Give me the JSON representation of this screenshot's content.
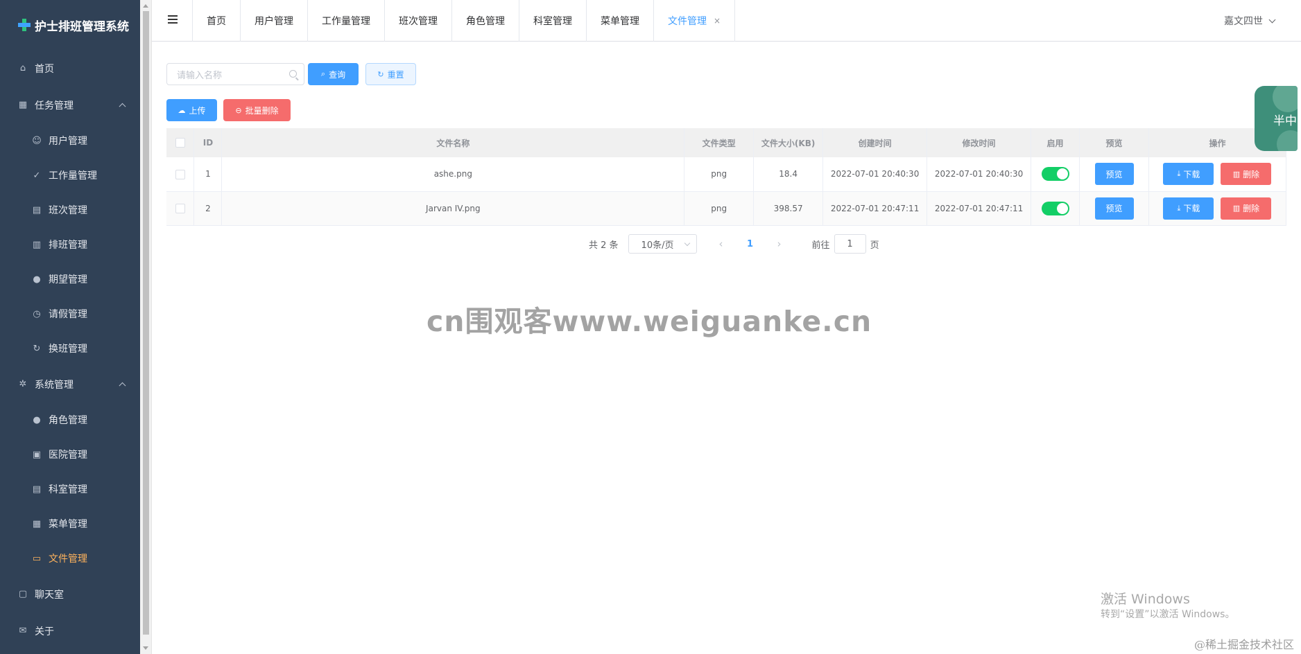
{
  "app": {
    "title": "护士排班管理系统"
  },
  "sidebar": {
    "items": [
      {
        "label": "首页",
        "icon": "home-icon",
        "level": "top"
      },
      {
        "label": "任务管理",
        "icon": "grid-icon",
        "level": "top",
        "expandable": true
      },
      {
        "label": "用户管理",
        "icon": "user-outline-icon",
        "level": "sub"
      },
      {
        "label": "工作量管理",
        "icon": "clipboard-check-icon",
        "level": "sub"
      },
      {
        "label": "班次管理",
        "icon": "clipboard-icon",
        "level": "sub"
      },
      {
        "label": "排班管理",
        "icon": "calendar-icon",
        "level": "sub"
      },
      {
        "label": "期望管理",
        "icon": "location-pin-icon",
        "level": "sub"
      },
      {
        "label": "请假管理",
        "icon": "clock-icon",
        "level": "sub"
      },
      {
        "label": "换班管理",
        "icon": "refresh-icon",
        "level": "sub"
      },
      {
        "label": "系统管理",
        "icon": "gear-icon",
        "level": "top",
        "expandable": true
      },
      {
        "label": "角色管理",
        "icon": "user-solid-icon",
        "level": "sub"
      },
      {
        "label": "医院管理",
        "icon": "office-building-icon",
        "level": "sub"
      },
      {
        "label": "科室管理",
        "icon": "building-icon",
        "level": "sub"
      },
      {
        "label": "菜单管理",
        "icon": "menu-grid-icon",
        "level": "sub"
      },
      {
        "label": "文件管理",
        "icon": "folder-icon",
        "level": "sub",
        "active": true
      },
      {
        "label": "聊天室",
        "icon": "chat-icon",
        "level": "top"
      },
      {
        "label": "关于",
        "icon": "message-icon",
        "level": "top"
      }
    ]
  },
  "header": {
    "tabs": [
      {
        "label": "首页"
      },
      {
        "label": "用户管理"
      },
      {
        "label": "工作量管理"
      },
      {
        "label": "班次管理"
      },
      {
        "label": "角色管理"
      },
      {
        "label": "科室管理"
      },
      {
        "label": "菜单管理"
      },
      {
        "label": "文件管理",
        "active": true,
        "closable": true
      }
    ],
    "close_glyph": "×",
    "user": "嘉文四世"
  },
  "toolbar": {
    "search_placeholder": "请输入名称",
    "query_label": "查询",
    "reset_label": "重置",
    "upload_label": "上传",
    "batch_delete_label": "批量删除"
  },
  "table": {
    "columns": [
      "ID",
      "文件名称",
      "文件类型",
      "文件大小(KB)",
      "创建时间",
      "修改时间",
      "启用",
      "预览",
      "操作"
    ],
    "rows": [
      {
        "id": "1",
        "name": "ashe.png",
        "type": "png",
        "size": "18.4",
        "created": "2022-07-01 20:40:30",
        "modified": "2022-07-01 20:40:30",
        "enabled": true
      },
      {
        "id": "2",
        "name": "Jarvan IV.png",
        "type": "png",
        "size": "398.57",
        "created": "2022-07-01 20:47:11",
        "modified": "2022-07-01 20:47:11",
        "enabled": true
      }
    ],
    "preview_label": "预览",
    "download_label": "下载",
    "delete_label": "删除"
  },
  "pagination": {
    "total_text": "共 2 条",
    "page_size": "10条/页",
    "current_page": "1",
    "goto_prefix": "前往",
    "goto_value": "1",
    "goto_suffix": "页"
  },
  "watermarks": {
    "center": "cn围观客www.weiguanke.cn",
    "windows_line1": "激活 Windows",
    "windows_line2": "转到“设置”以激活 Windows。",
    "corner": "@稀土掘金技术社区"
  },
  "widget": {
    "text": "半中"
  },
  "colors": {
    "sidebar_bg": "#304156",
    "primary": "#409eff",
    "danger": "#f56c6c",
    "active_menu": "#ffb35c",
    "switch_on": "#13ce66"
  }
}
